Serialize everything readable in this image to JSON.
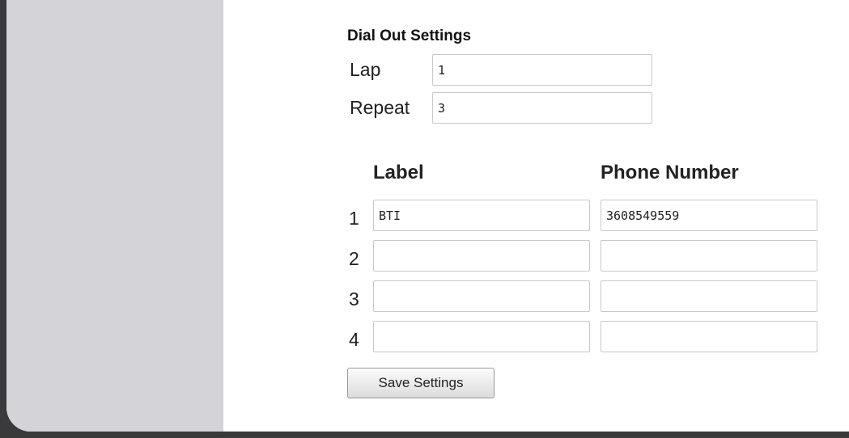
{
  "section_title": "Dial Out Settings",
  "lap": {
    "label": "Lap",
    "value": "1"
  },
  "repeat": {
    "label": "Repeat",
    "value": "3"
  },
  "columns": {
    "label": "Label",
    "phone": "Phone Number"
  },
  "rows": [
    {
      "num": "1",
      "label": "BTI",
      "phone": "3608549559"
    },
    {
      "num": "2",
      "label": "",
      "phone": ""
    },
    {
      "num": "3",
      "label": "",
      "phone": ""
    },
    {
      "num": "4",
      "label": "",
      "phone": ""
    }
  ],
  "save_label": "Save Settings"
}
